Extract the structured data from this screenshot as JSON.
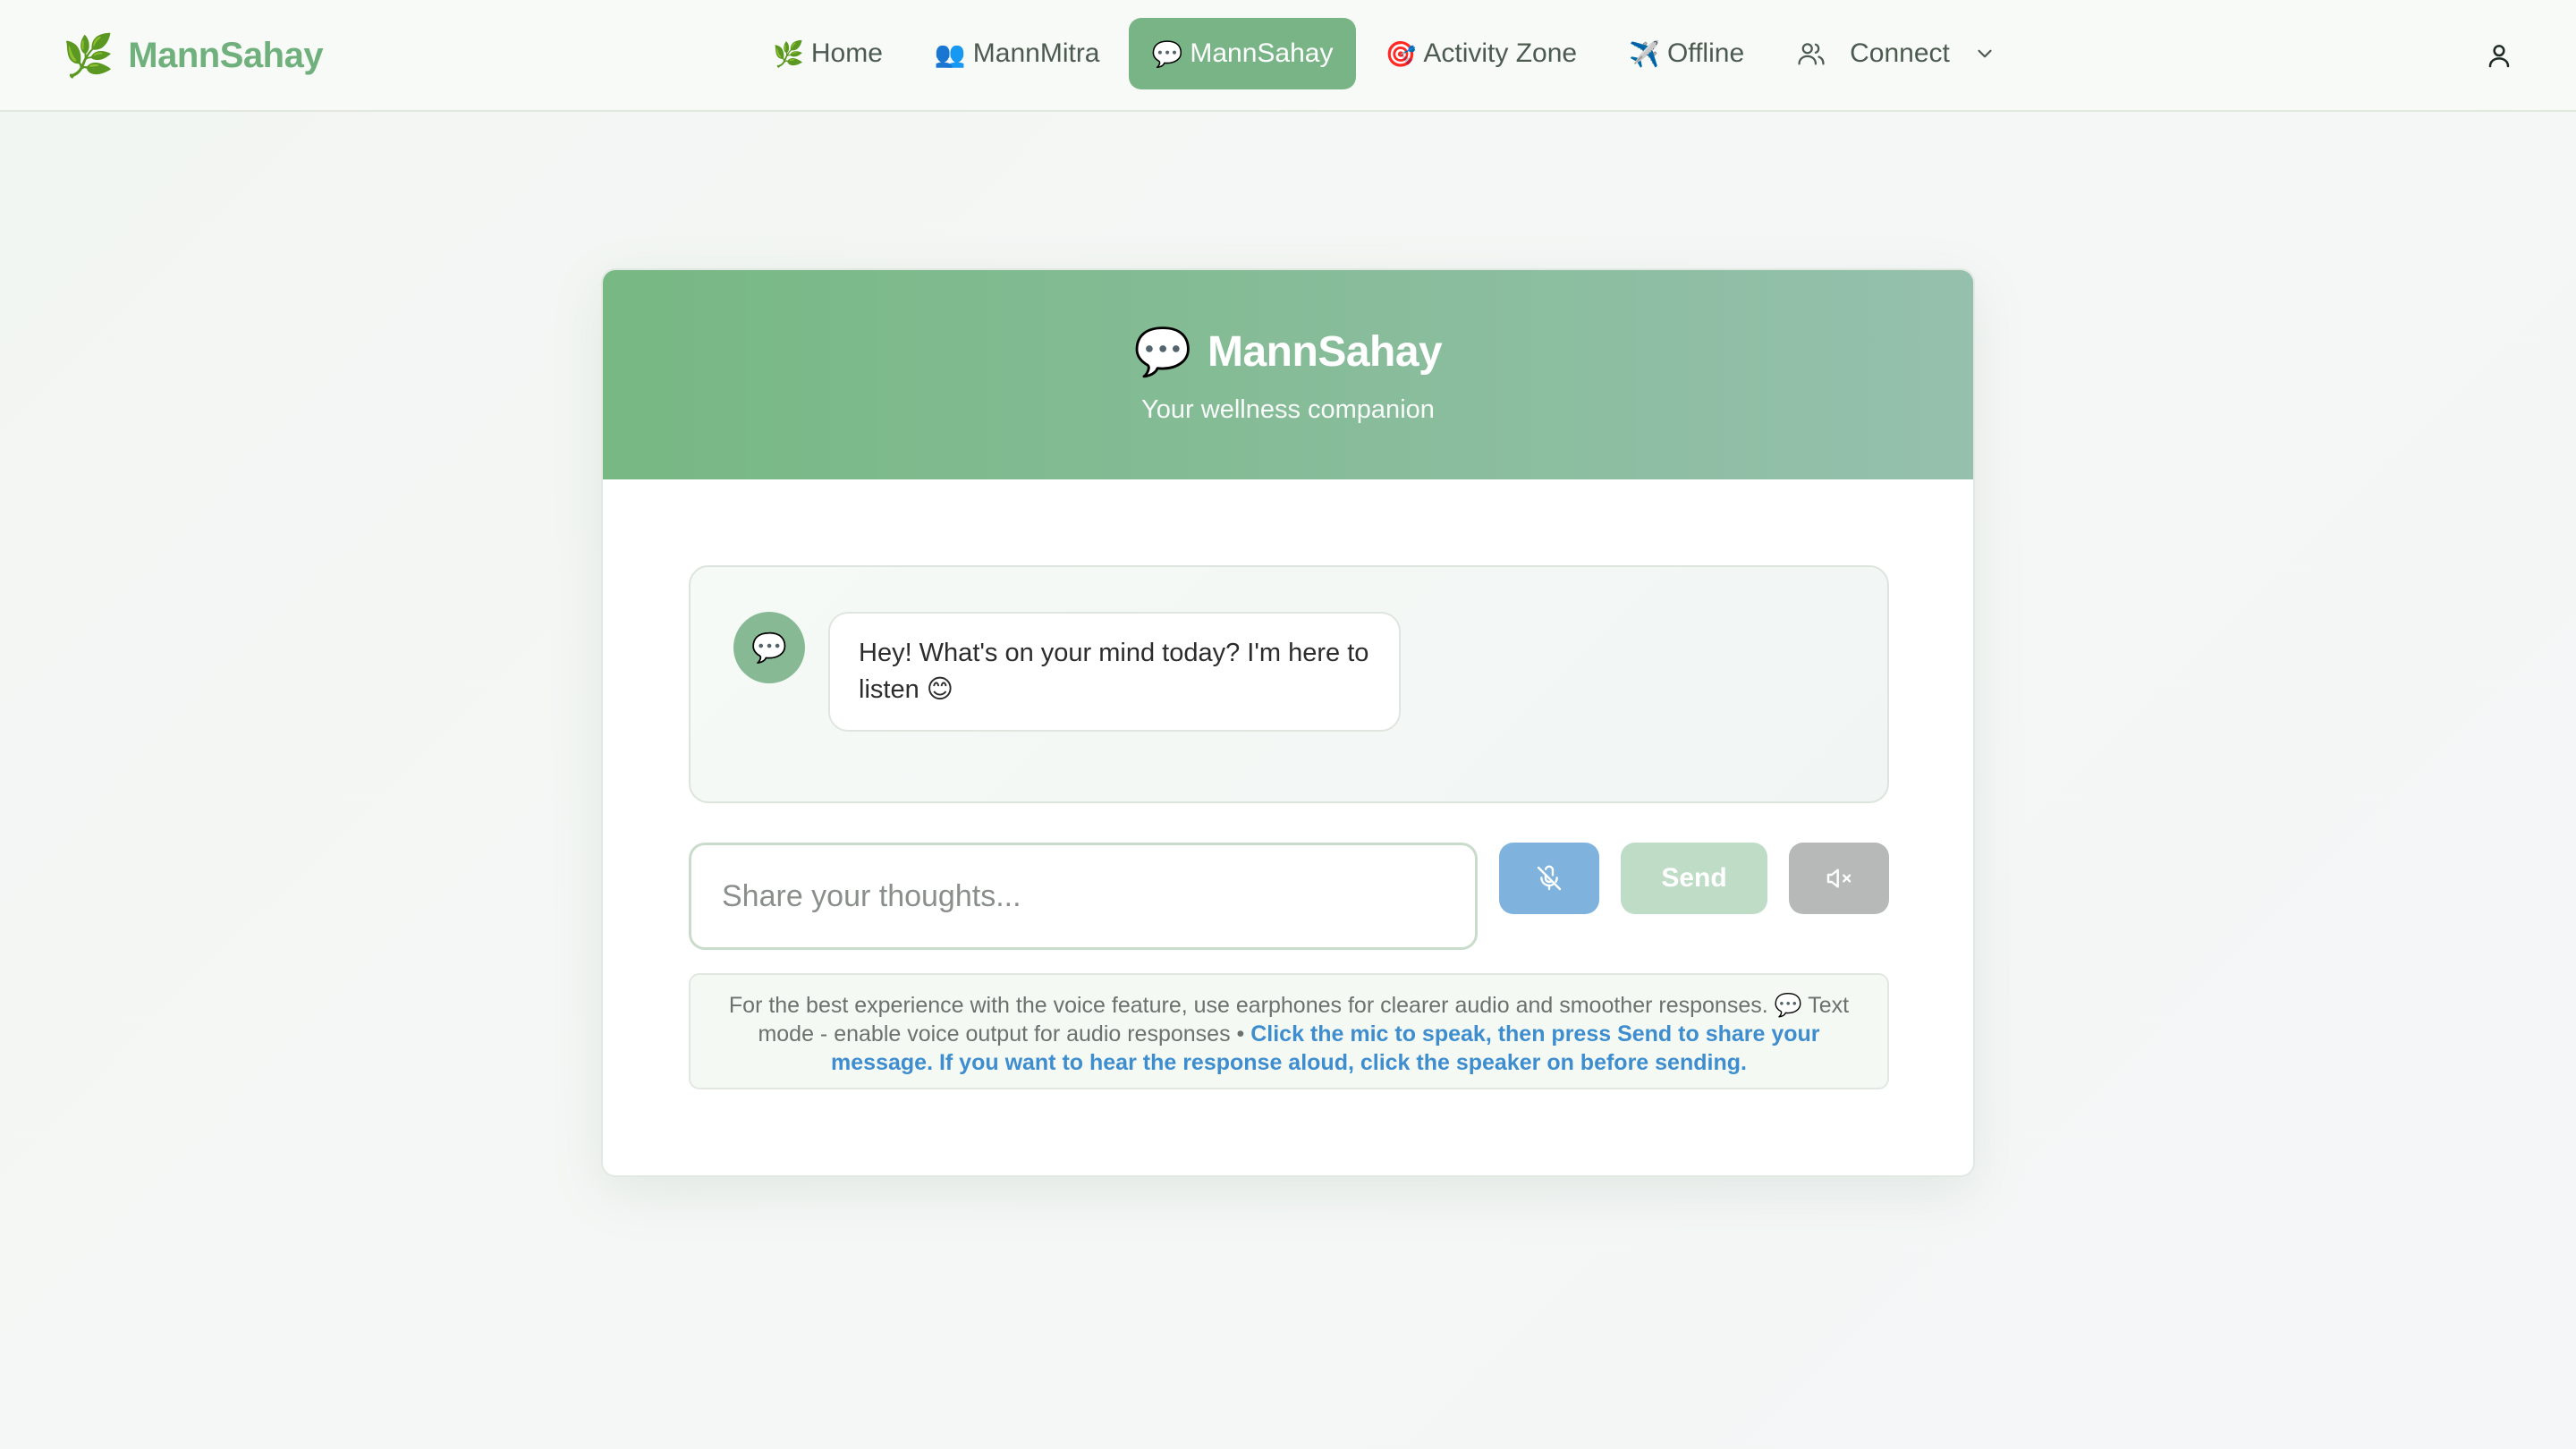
{
  "brand": {
    "name": "MannSahay",
    "icon": "leaf-icon"
  },
  "nav": {
    "items": [
      {
        "emoji": "🌿",
        "label": "Home",
        "active": false
      },
      {
        "emoji": "👥",
        "label": "MannMitra",
        "active": false
      },
      {
        "emoji": "💬",
        "label": "MannSahay",
        "active": true
      },
      {
        "emoji": "🎯",
        "label": "Activity Zone",
        "active": false
      },
      {
        "emoji": "✈️",
        "label": "Offline",
        "active": false
      }
    ],
    "connect_label": "Connect"
  },
  "card": {
    "title_emoji": "💬",
    "title": "MannSahay",
    "subtitle": "Your wellness companion"
  },
  "chat": {
    "bot_avatar_emoji": "💬",
    "messages": [
      {
        "from": "bot",
        "text": "Hey! What's on your mind today? I'm here to listen 😊"
      }
    ]
  },
  "composer": {
    "placeholder": "Share your thoughts...",
    "send_label": "Send"
  },
  "hint": {
    "normal": "For the best experience with the voice feature, use earphones for clearer audio and smoother responses. 💬 Text mode - enable voice output for audio responses • ",
    "highlight": "Click the mic to speak, then press Send to share your message. If you want to hear the response aloud, click the speaker on before sending."
  },
  "colors": {
    "accent": "#78b486",
    "brand_text": "#6fb07d",
    "mic_button": "#7fb3de",
    "send_button": "#bfdcc7",
    "speaker_button": "#b7b9b8",
    "hint_link": "#3d8dcf"
  }
}
